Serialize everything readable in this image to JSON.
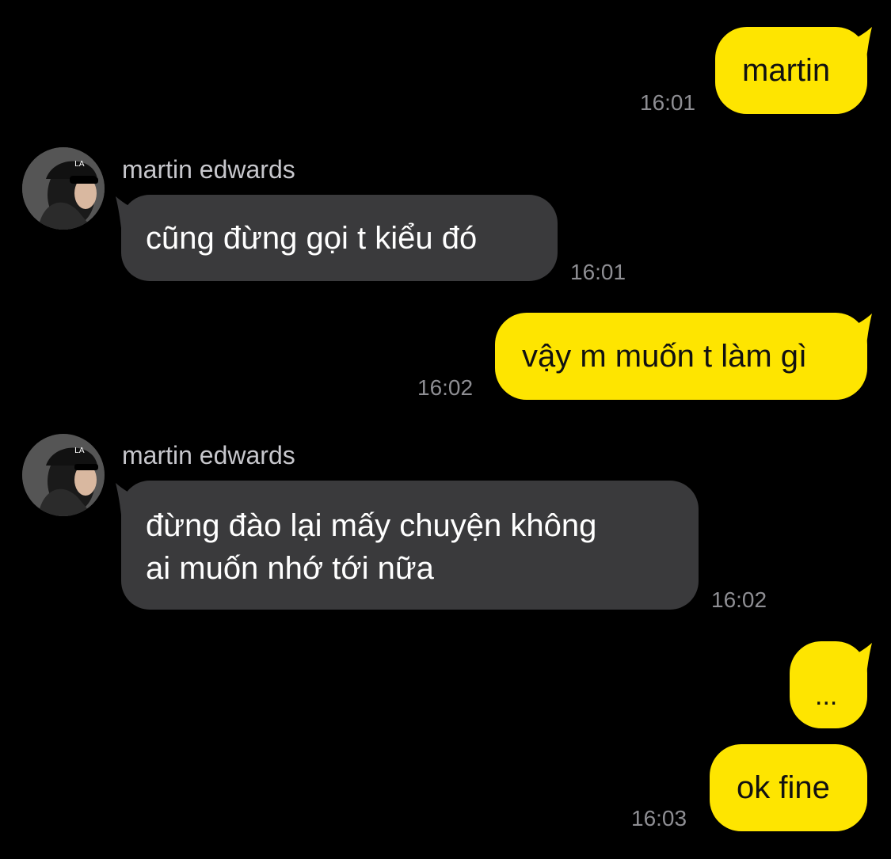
{
  "colors": {
    "background": "#000000",
    "outgoing_bubble": "#FEE500",
    "incoming_bubble": "#3A3A3C",
    "timestamp": "#8E8E93",
    "sender_name": "#C7C7CC"
  },
  "messages": [
    {
      "direction": "outgoing",
      "text": "martin",
      "time": "16:01"
    },
    {
      "direction": "incoming",
      "sender": "martin edwards",
      "avatar_icon": "user-avatar-icon",
      "text": "cũng đừng gọi t kiểu đó",
      "time": "16:01"
    },
    {
      "direction": "outgoing",
      "text": "vậy m muốn t làm gì",
      "time": "16:02"
    },
    {
      "direction": "incoming",
      "sender": "martin edwards",
      "avatar_icon": "user-avatar-icon",
      "lines": [
        "đừng đào lại mấy chuyện không",
        "ai muốn nhớ tới nữa"
      ],
      "time": "16:02"
    },
    {
      "direction": "outgoing",
      "text": "...",
      "time": ""
    },
    {
      "direction": "outgoing",
      "text": "ok fine",
      "time": "16:03"
    }
  ]
}
